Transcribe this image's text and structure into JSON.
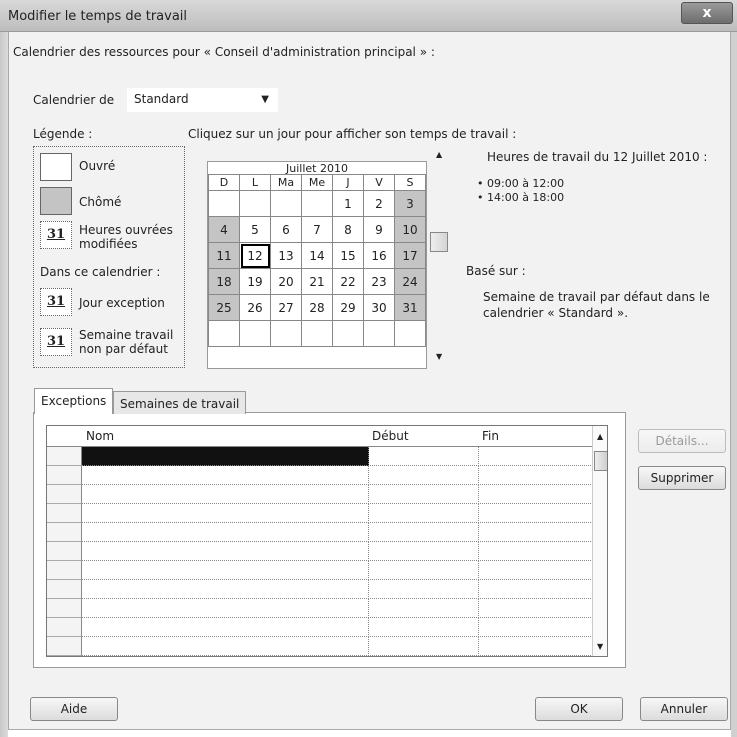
{
  "window": {
    "title": "Modifier le temps de travail",
    "close_label": "x"
  },
  "header_label": "Calendrier des ressources pour « Conseil d'administration principal » :",
  "calendar_selector": {
    "label": "Calendrier de",
    "value": "Standard"
  },
  "legend": {
    "title": "Légende :",
    "items": [
      {
        "label": "Ouvré"
      },
      {
        "label": "Chômé"
      },
      {
        "badge": "31",
        "label_line1": "Heures ouvrées",
        "label_line2": "modifiées"
      }
    ],
    "section_title": "Dans ce calendrier :",
    "calendar_items": [
      {
        "badge": "31",
        "label": "Jour exception"
      },
      {
        "badge": "31",
        "label_line1": "Semaine travail",
        "label_line2": "non par défaut"
      }
    ]
  },
  "instruction": "Cliquez sur un jour pour afficher son temps de travail :",
  "calendar": {
    "month_title": "Juillet 2010",
    "days_of_week": [
      "D",
      "L",
      "Ma",
      "Me",
      "J",
      "V",
      "S"
    ],
    "weeks": [
      [
        "",
        "",
        "",
        "",
        "1",
        "2",
        "3"
      ],
      [
        "4",
        "5",
        "6",
        "7",
        "8",
        "9",
        "10"
      ],
      [
        "11",
        "12",
        "13",
        "14",
        "15",
        "16",
        "17"
      ],
      [
        "18",
        "19",
        "20",
        "21",
        "22",
        "23",
        "24"
      ],
      [
        "25",
        "26",
        "27",
        "28",
        "29",
        "30",
        "31"
      ],
      [
        "",
        "",
        "",
        "",
        "",
        "",
        ""
      ]
    ],
    "selected_day": "12"
  },
  "working_hours": {
    "title": "Heures de travail du 12 Juillet 2010 :",
    "slots": [
      "09:00 à 12:00",
      "14:00 à 18:00"
    ],
    "based_on_label": "Basé sur :",
    "based_on_line1": "Semaine de travail par défaut dans le",
    "based_on_line2": "calendrier « Standard »."
  },
  "tabs": [
    {
      "label": "Exceptions",
      "active": true
    },
    {
      "label": "Semaines de travail",
      "active": false
    }
  ],
  "grid": {
    "columns": [
      "Nom",
      "Début",
      "Fin"
    ],
    "row_count": 11
  },
  "side_buttons": {
    "details": "Détails...",
    "delete": "Supprimer"
  },
  "footer_buttons": {
    "help": "Aide",
    "ok": "OK",
    "cancel": "Annuler"
  }
}
